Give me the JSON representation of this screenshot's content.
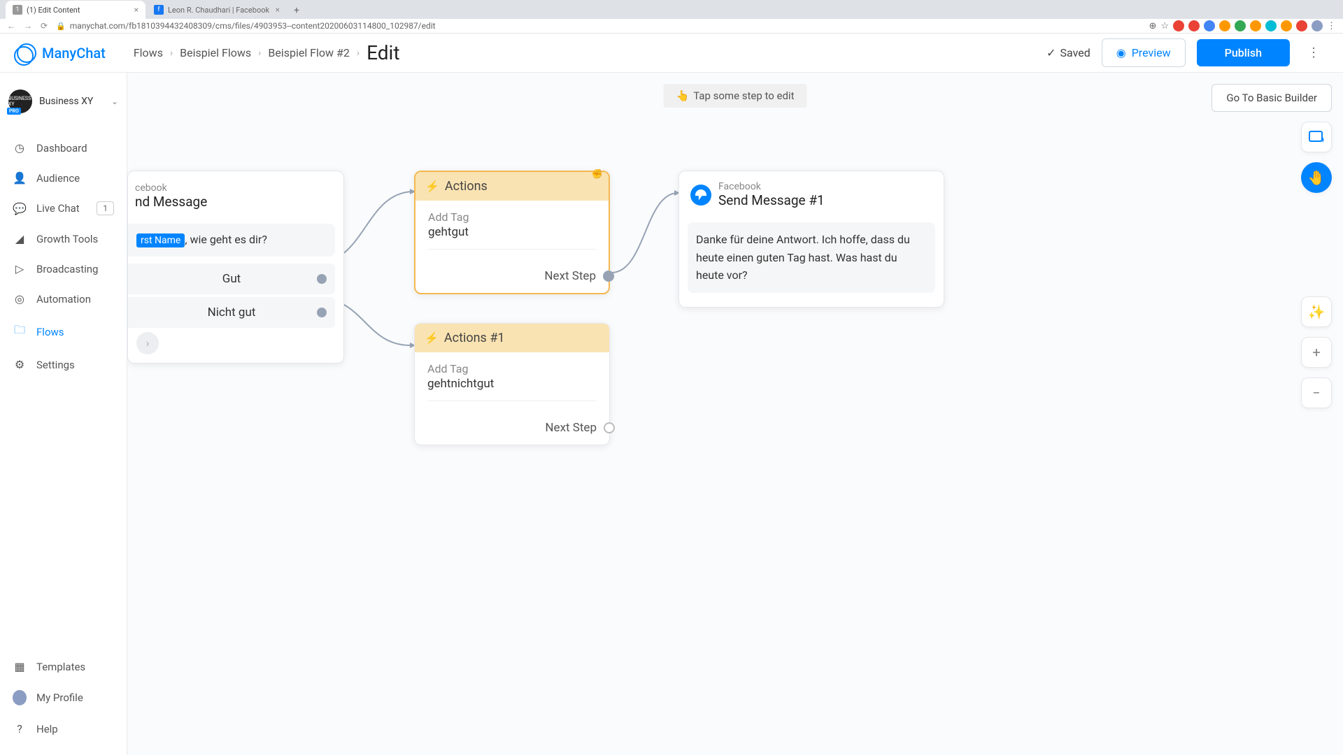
{
  "browser": {
    "tabs": [
      {
        "title": "(1) Edit Content",
        "favicon": "1"
      },
      {
        "title": "Leon R. Chaudhari | Facebook",
        "favicon": "f"
      }
    ],
    "url": "manychat.com/fb181039443240830​9/cms/files/4903953--content20200603114800_102987/edit"
  },
  "header": {
    "logo": "ManyChat",
    "breadcrumb": [
      "Flows",
      "Beispiel Flows",
      "Beispiel Flow #2"
    ],
    "current": "Edit",
    "saved": "Saved",
    "preview": "Preview",
    "publish": "Publish"
  },
  "sidebar": {
    "business": {
      "name": "Business XY",
      "badge": "PRO"
    },
    "nav": {
      "dashboard": "Dashboard",
      "audience": "Audience",
      "livechat": "Live Chat",
      "livechat_badge": "1",
      "growth": "Growth Tools",
      "broadcasting": "Broadcasting",
      "automation": "Automation",
      "flows": "Flows",
      "settings": "Settings"
    },
    "bottom": {
      "templates": "Templates",
      "profile": "My Profile",
      "help": "Help"
    }
  },
  "canvas": {
    "hint": "Tap some step to edit",
    "goBasic": "Go To Basic Builder",
    "nodeMsg": {
      "platform": "cebook",
      "title": "nd Message",
      "varPill": "rst Name",
      "textAfter": ", wie geht es dir?",
      "reply1": "Gut",
      "reply2": "Nicht gut"
    },
    "actions1": {
      "title": "Actions",
      "actionLabel": "Add Tag",
      "actionValue": "gehtgut",
      "next": "Next Step"
    },
    "actions2": {
      "title": "Actions #1",
      "actionLabel": "Add Tag",
      "actionValue": "gehtnichtgut",
      "next": "Next Step"
    },
    "nodeMsg2": {
      "platform": "Facebook",
      "title": "Send Message #1",
      "text": "Danke für deine Antwort. Ich hoffe, dass du heute einen guten Tag hast. Was hast du heute vor?"
    }
  }
}
